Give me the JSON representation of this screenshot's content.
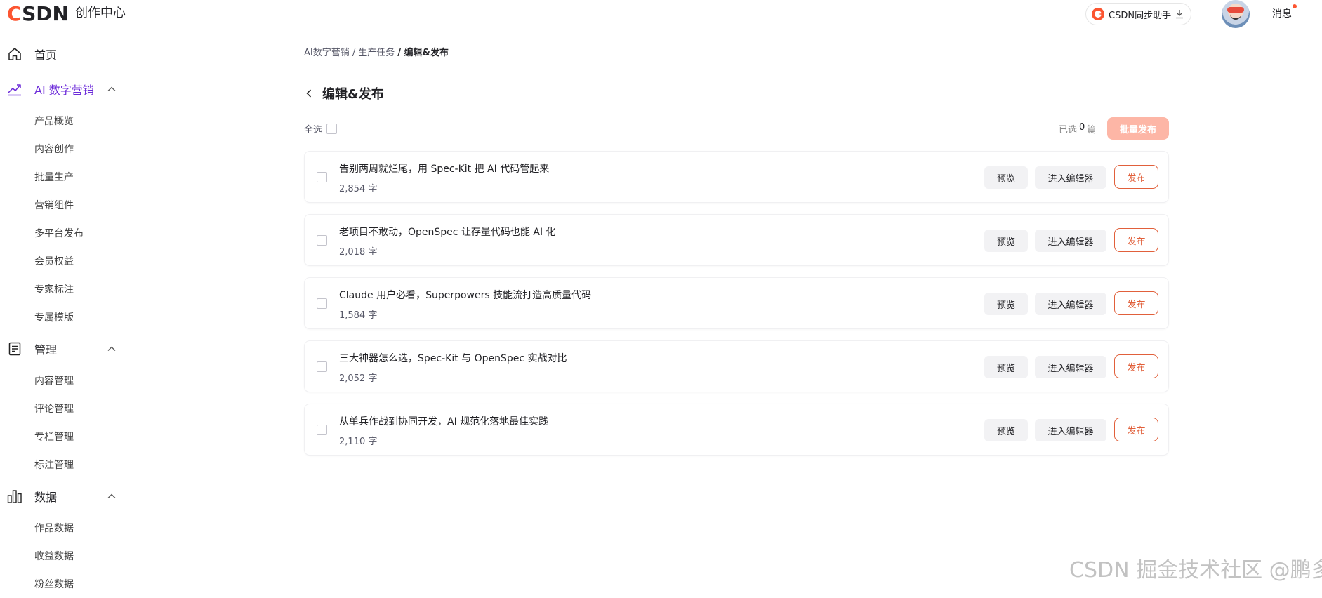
{
  "header": {
    "logo_text": "CSDN",
    "center_title": "创作中心",
    "sync_helper_label": "CSDN同步助手",
    "messages_label": "消息"
  },
  "sidebar": {
    "home": {
      "label": "首页",
      "icon": "home-icon"
    },
    "groups": [
      {
        "label": "AI 数字营销",
        "icon": "trend-chart-icon",
        "active": true,
        "items": [
          "产品概览",
          "内容创作",
          "批量生产",
          "营销组件",
          "多平台发布",
          "会员权益",
          "专家标注",
          "专属模版"
        ]
      },
      {
        "label": "管理",
        "icon": "document-icon",
        "items": [
          "内容管理",
          "评论管理",
          "专栏管理",
          "标注管理"
        ]
      },
      {
        "label": "数据",
        "icon": "bar-chart-icon",
        "items": [
          "作品数据",
          "收益数据",
          "粉丝数据"
        ]
      }
    ]
  },
  "breadcrumb": {
    "items": [
      "AI数字营销 /",
      "生产任务",
      "/ 编辑&发布"
    ]
  },
  "page": {
    "title": "编辑&发布",
    "select_all_label": "全选",
    "selected_prefix": "已选",
    "selected_count": "0",
    "selected_suffix": "篇",
    "batch_publish_label": "批量发布"
  },
  "actions": {
    "preview_label": "预览",
    "editor_label": "进入编辑器",
    "publish_label": "发布"
  },
  "articles": [
    {
      "title": "告别两周就烂尾，用 Spec-Kit 把 AI 代码管起来",
      "count": "2,854 字"
    },
    {
      "title": "老项目不敢动，OpenSpec 让存量代码也能 AI 化",
      "count": "2,018 字"
    },
    {
      "title": "Claude 用户必看，Superpowers 技能流打造高质量代码",
      "count": "1,584 字"
    },
    {
      "title": "三大神器怎么选，Spec-Kit 与 OpenSpec 实战对比",
      "count": "2,052 字"
    },
    {
      "title": "从单兵作战到协同开发，AI 规范化落地最佳实践",
      "count": "2,110 字"
    }
  ],
  "watermark": "CSDN 掘金技术社区 @鹏多多",
  "colors": {
    "brand": "#fc5531",
    "active_nav": "#6c2bd9",
    "publish_border": "#e1603b",
    "batch_publish_disabled": "#fdb6a6"
  }
}
